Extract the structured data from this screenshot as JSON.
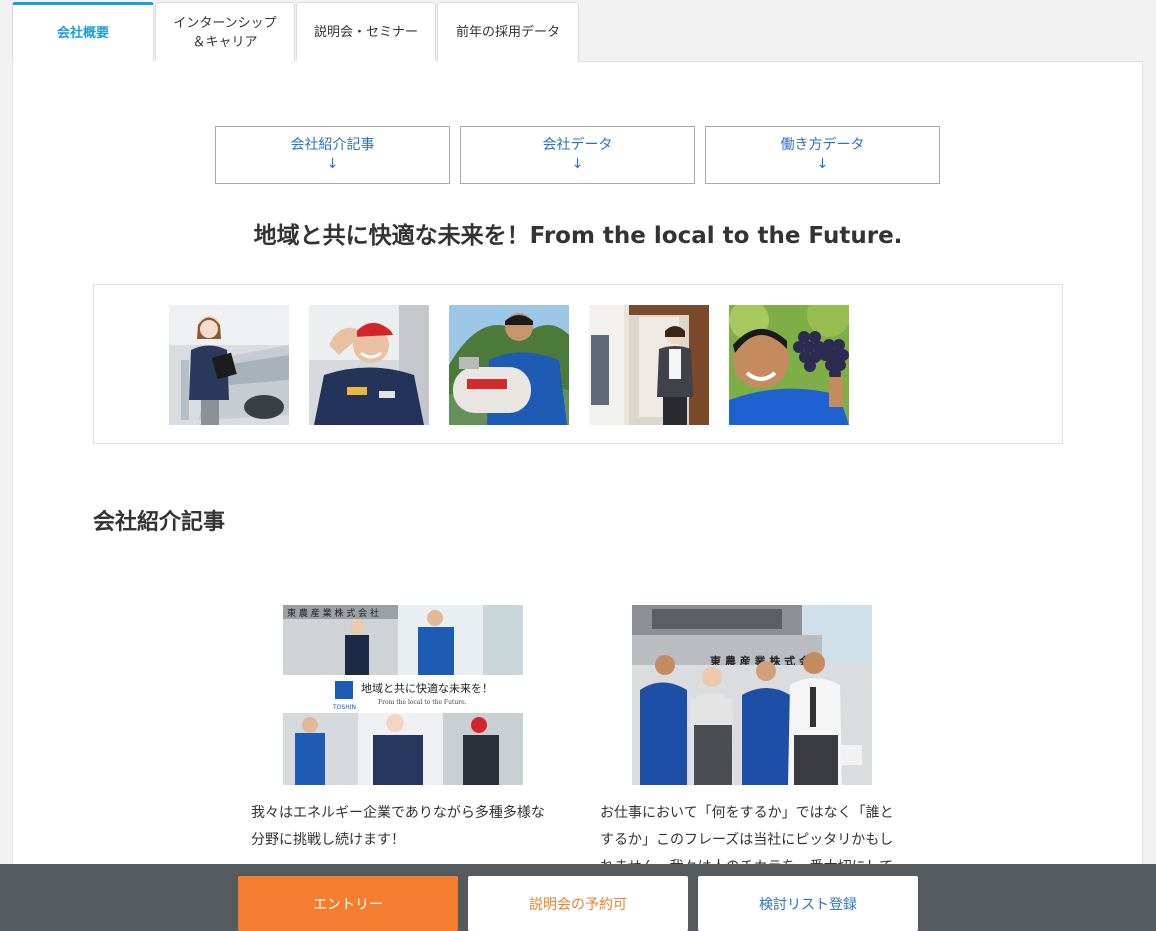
{
  "tabs": [
    {
      "label": "会社概要",
      "active": true
    },
    {
      "label": "インターンシップ\n＆キャリア"
    },
    {
      "label": "説明会・セミナー"
    },
    {
      "label": "前年の採用データ"
    }
  ],
  "anchors": [
    {
      "label": "会社紹介記事",
      "arrow": "↓"
    },
    {
      "label": "会社データ",
      "arrow": "↓"
    },
    {
      "label": "働き方データ",
      "arrow": "↓"
    }
  ],
  "tagline": "地域と共に快適な未来を！From the local to the Future.",
  "section_title": "会社紹介記事",
  "articles": [
    {
      "banner_sign": "東 農 産 業 株 式 会 社",
      "banner_title": "地域と共に快適な未来を！",
      "banner_sub": "From the local to the Future.",
      "banner_logo": "TOSHIN",
      "text": "我々はエネルギー企業でありながら多種多様な分野に挑戦し続けます！"
    },
    {
      "banner_sign": "東 農 産 業 株 式 会 社",
      "text": "お仕事において「何をするか」ではなく「誰とするか」このフレーズは当社にピッタリかもしれません。我々は人のチカラを一番大切にして"
    }
  ],
  "footer": {
    "entry": "エントリー",
    "seminar": "説明会の予約可",
    "list": "検討リスト登録"
  },
  "colors": {
    "accent": "#1aa0d8",
    "link": "#2b72c4",
    "orange": "#f47d30",
    "footer_bg": "#555a5f"
  }
}
